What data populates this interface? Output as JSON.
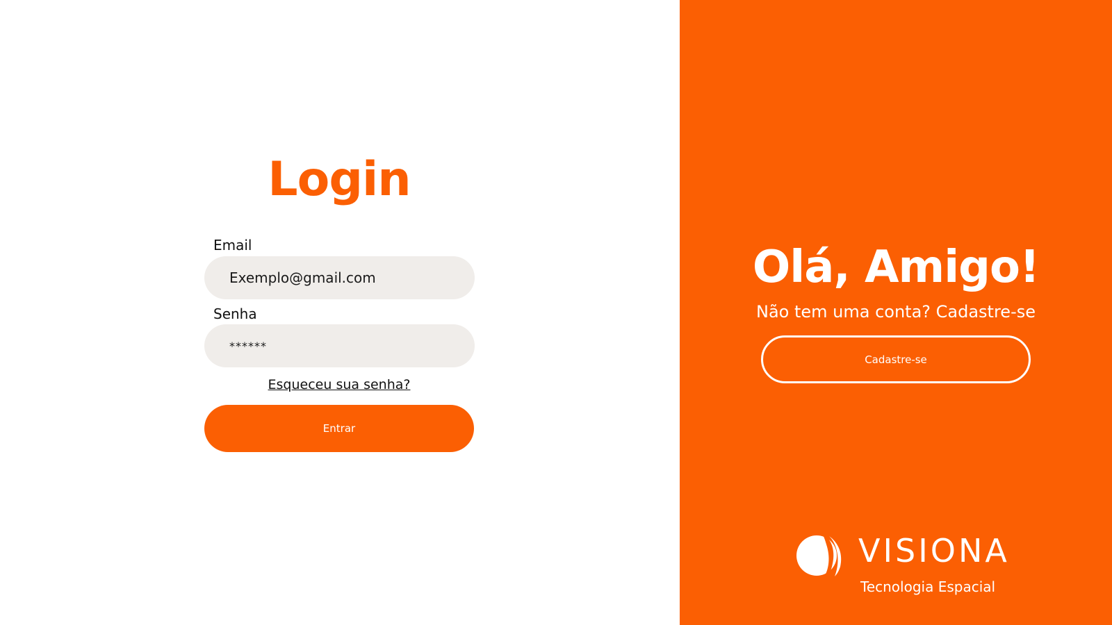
{
  "colors": {
    "accent": "#fb5f03",
    "input_bg": "#f0edea",
    "text": "#111111",
    "white": "#ffffff"
  },
  "login": {
    "title": "Login",
    "email_label": "Email",
    "email_value": "Exemplo@gmail.com",
    "password_label": "Senha",
    "password_value": "******",
    "forgot_link": "Esqueceu sua senha?",
    "submit_label": "Entrar"
  },
  "signup_panel": {
    "greeting": "Olá, Amigo!",
    "subtitle": "Não tem uma conta? Cadastre-se",
    "button_label": "Cadastre-se"
  },
  "brand": {
    "name": "VISIONA",
    "tagline": "Tecnologia Espacial",
    "icon": "visiona-logo-icon"
  }
}
